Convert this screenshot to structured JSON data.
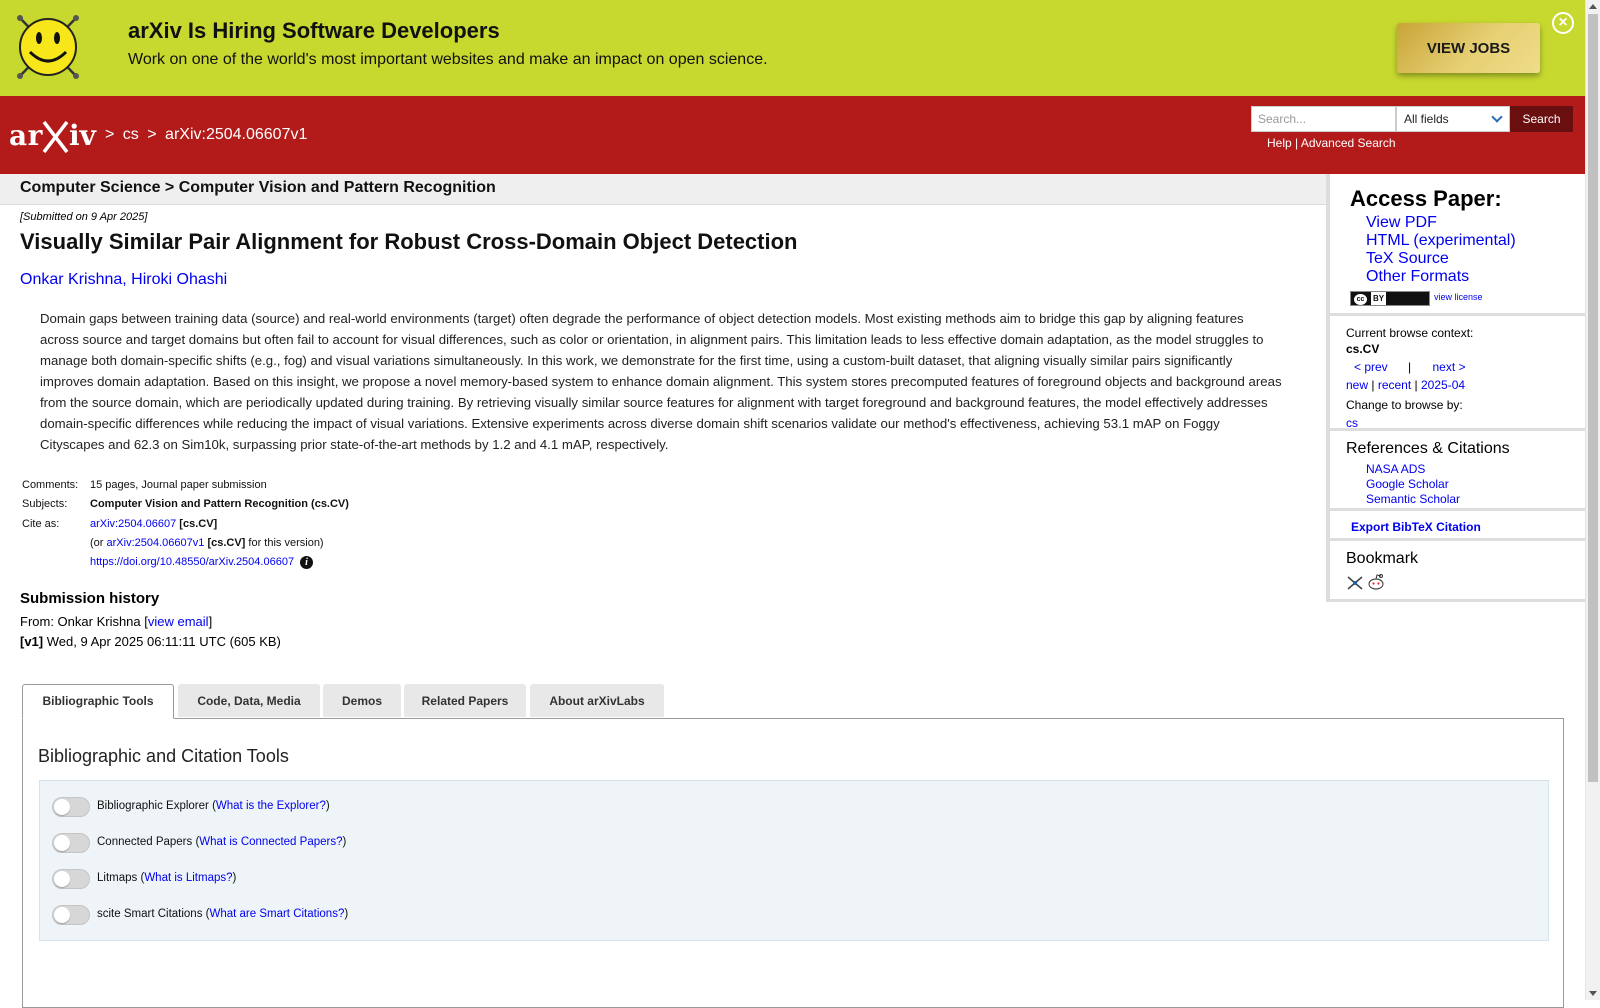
{
  "banner": {
    "title": "arXiv Is Hiring Software Developers",
    "subtitle": "Work on one of the world's most important websites and make an impact on open science.",
    "button_label": "VIEW JOBS",
    "close_icon": "×"
  },
  "header": {
    "logo_text": "arXiv",
    "breadcrumb": [
      ">",
      "cs",
      ">",
      "arXiv:2504.06607v1"
    ],
    "search_placeholder": "Search...",
    "search_field": "All fields",
    "search_button": "Search",
    "help": "Help",
    "separator": "|",
    "advanced_search": "Advanced Search"
  },
  "category_bar": "Computer Science > Computer Vision and Pattern Recognition",
  "paper": {
    "submitted": "[Submitted on 9 Apr 2025]",
    "title": "Visually Similar Pair Alignment for Robust Cross-Domain Object Detection",
    "authors": [
      "Onkar Krishna",
      "Hiroki Ohashi"
    ],
    "author_separator": ", ",
    "abstract": "Domain gaps between training data (source) and real-world environments (target) often degrade the performance of object detection models. Most existing methods aim to bridge this gap by aligning features across source and target domains but often fail to account for visual differences, such as color or orientation, in alignment pairs. This limitation leads to less effective domain adaptation, as the model struggles to manage both domain-specific shifts (e.g., fog) and visual variations simultaneously. In this work, we demonstrate for the first time, using a custom-built dataset, that aligning visually similar pairs significantly improves domain adaptation. Based on this insight, we propose a novel memory-based system to enhance domain alignment. This system stores precomputed features of foreground objects and background areas from the source domain, which are periodically updated during training. By retrieving visually similar source features for alignment with target foreground and background features, the model effectively addresses domain-specific differences while reducing the impact of visual variations. Extensive experiments across diverse domain shift scenarios validate our method's effectiveness, achieving 53.1 mAP on Foggy Cityscapes and 62.3 on Sim10k, surpassing prior state-of-the-art methods by 1.2 and 4.1 mAP, respectively.",
    "meta": {
      "comments_label": "Comments:",
      "comments": "15 pages, Journal paper submission",
      "subjects_label": "Subjects:",
      "subjects": "Computer Vision and Pattern Recognition (cs.CV)",
      "cite_label": "Cite as:",
      "cite_id": "arXiv:2504.06607",
      "cite_cat": "[cs.CV]",
      "cite_or_open": "(or",
      "cite_version_id": "arXiv:2504.06607v1",
      "cite_version_cat": "[cs.CV]",
      "cite_version_tail": "for this version)",
      "doi": "https://doi.org/10.48550/arXiv.2504.06607",
      "info_icon": "i"
    },
    "history": {
      "title": "Submission history",
      "from_label": "From: Onkar Krishna [",
      "view_email": "view email",
      "from_close": "]",
      "v1_tag": "[v1]",
      "v1_text": "Wed, 9 Apr 2025 06:11:11 UTC (605 KB)"
    }
  },
  "tabs": [
    "Bibliographic Tools",
    "Code, Data, Media",
    "Demos",
    "Related Papers",
    "About arXivLabs"
  ],
  "tab_panel": {
    "heading": "Bibliographic and Citation Tools",
    "tools": [
      {
        "label": "Bibliographic Explorer",
        "link": "What is the Explorer?"
      },
      {
        "label": "Connected Papers",
        "link": "What is Connected Papers?"
      },
      {
        "label": "Litmaps",
        "link": "What is Litmaps?"
      },
      {
        "label": "scite Smart Citations",
        "link": "What are Smart Citations?"
      }
    ]
  },
  "sidebar": {
    "access_title": "Access Paper:",
    "access_links": [
      "View PDF",
      "HTML (experimental)",
      "TeX Source",
      "Other Formats"
    ],
    "cc_label": "cc",
    "cc_by": "BY",
    "view_license": "view license",
    "browse_context_label": "Current browse context:",
    "browse_context": "cs.CV",
    "prev": "< prev",
    "pipe": "|",
    "next": "next >",
    "new": "new",
    "recent": "recent",
    "month": "2025-04",
    "change_browse_label": "Change to browse by:",
    "change_browse": "cs",
    "refs_title": "References & Citations",
    "refs_links": [
      "NASA ADS",
      "Google Scholar",
      "Semantic Scholar"
    ],
    "export": "Export BibTeX Citation",
    "bookmark_title": "Bookmark"
  },
  "colors": {
    "banner_bg": "#c7d92f",
    "header_bg": "#b31b1b",
    "link": "#0000ee"
  }
}
